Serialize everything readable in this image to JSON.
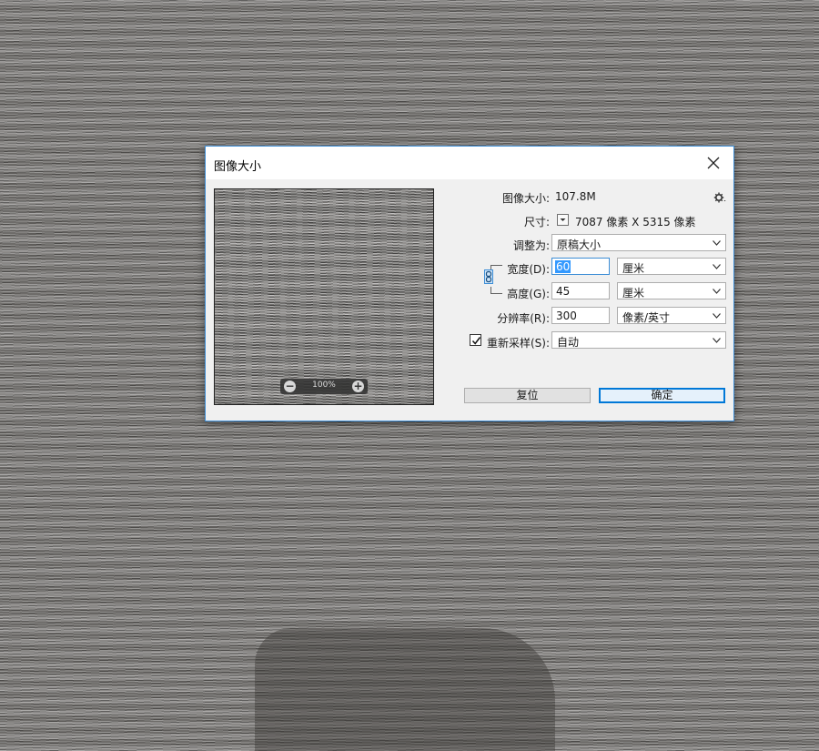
{
  "dialog": {
    "title": "图像大小",
    "image_size_label": "图像大小:",
    "image_size_value": "107.8M",
    "dimensions_label": "尺寸:",
    "dimensions_value": "7087 像素  X  5315 像素",
    "fit_to_label": "调整为:",
    "fit_to_value": "原稿大小",
    "width_label": "宽度(D):",
    "width_value": "60",
    "width_unit": "厘米",
    "height_label": "高度(G):",
    "height_value": "45",
    "height_unit": "厘米",
    "resolution_label": "分辨率(R):",
    "resolution_value": "300",
    "resolution_unit": "像素/英寸",
    "resample_label": "重新采样(S):",
    "resample_checked": true,
    "resample_value": "自动",
    "preview_zoom": "100%",
    "reset_button": "复位",
    "ok_button": "确定"
  },
  "colors": {
    "accent": "#3c8dd6",
    "dialog_bg": "#f0f0f0",
    "selection": "#3399ff"
  }
}
